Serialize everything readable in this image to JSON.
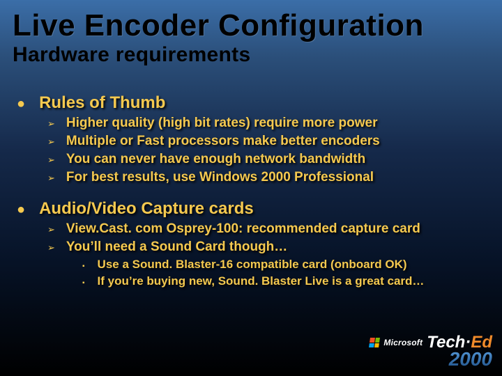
{
  "title": "Live Encoder Configuration",
  "subtitle": "Hardware requirements",
  "sections": [
    {
      "heading": "Rules of Thumb",
      "items": [
        {
          "text": "Higher quality (high bit rates) require more power"
        },
        {
          "text": "Multiple or Fast processors make better encoders"
        },
        {
          "text": "You can never have enough network bandwidth"
        },
        {
          "text": "For best results, use Windows 2000 Professional"
        }
      ]
    },
    {
      "heading": "Audio/Video Capture cards",
      "items": [
        {
          "text": "View.Cast. com Osprey-100: recommended capture card"
        },
        {
          "text": "You’ll need a Sound Card though…",
          "subitems": [
            "Use a Sound. Blaster-16 compatible card (onboard OK)",
            "If you’re buying new, Sound. Blaster Live is a great card…"
          ]
        }
      ]
    }
  ],
  "logo": {
    "company": "Microsoft",
    "brand_part1": "Tech·",
    "brand_part2": "Ed",
    "year": "2000"
  },
  "bullets": {
    "l1": "●",
    "l2": "➢",
    "l3": "▪"
  }
}
